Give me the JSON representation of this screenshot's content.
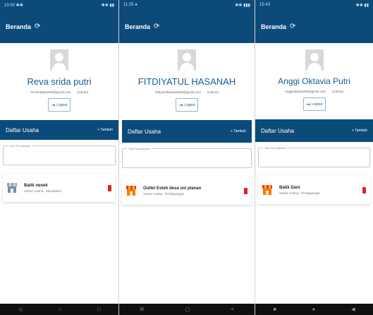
{
  "colors": {
    "primary": "#0c4a7a",
    "name_blue": "#1a5a9a",
    "delete_red": "#e02020"
  },
  "phones": [
    {
      "status": {
        "left": "10:00 ✱✱",
        "right": "✱✱ ▮▮"
      },
      "appbar": {
        "title": "Beranda",
        "refresh_icon": "⟳"
      },
      "profile": {
        "name": "Reva srida putri",
        "email": "revasridaputri99@gmail.com",
        "role": "[Admin]"
      },
      "logout": {
        "icon": "⇥",
        "label": "Logout"
      },
      "section": {
        "title": "Daftar Usaha",
        "add": "+ Tambah"
      },
      "search": {
        "placeholder": "Cari Perusahaan"
      },
      "items": [
        {
          "name": "Batik nenek",
          "sub": "Sektor Usaha : Manufaktur"
        }
      ],
      "nav": {
        "back": "◁",
        "home": "○",
        "recent": "□"
      }
    },
    {
      "status": {
        "left": "11:25 ●",
        "right": "✱✱ ▮▮▮"
      },
      "appbar": {
        "title": "Beranda",
        "refresh_icon": "⟳"
      },
      "profile": {
        "name": "FITDIYATUL HASANAH",
        "email": "fitdiyatulhasanahdia@gmail.com",
        "role": "[Admin]"
      },
      "logout": {
        "icon": "⇥",
        "label": "Logout"
      },
      "section": {
        "title": "Daftar Usaha",
        "add": "+ Tambah"
      },
      "search": {
        "placeholder": "Cari Perusahaan"
      },
      "items": [
        {
          "name": "Outlet Esteh desa uni planan",
          "sub": "Sektor Usaha : Perdagangan"
        }
      ],
      "nav": {
        "back": "III",
        "home": "▢",
        "recent": "<"
      }
    },
    {
      "status": {
        "left": "15:43",
        "right": "✱✱ ▮▮"
      },
      "appbar": {
        "title": "Beranda",
        "refresh_icon": "⟳"
      },
      "profile": {
        "name": "Anggi Oktavia Putri",
        "email": "anggioktavia456@gmail.com",
        "role": "[Admin]"
      },
      "logout": {
        "icon": "⇥",
        "label": "Logout"
      },
      "section": {
        "title": "Daftar Usaha",
        "add": "+ Tambah"
      },
      "search": {
        "placeholder": "Cari Perusahaan"
      },
      "items": [
        {
          "name": "Batik Dani",
          "sub": "Sektor Usaha : Perdagangan"
        }
      ],
      "nav": {
        "back": "■",
        "home": "●",
        "recent": "◀"
      }
    }
  ]
}
